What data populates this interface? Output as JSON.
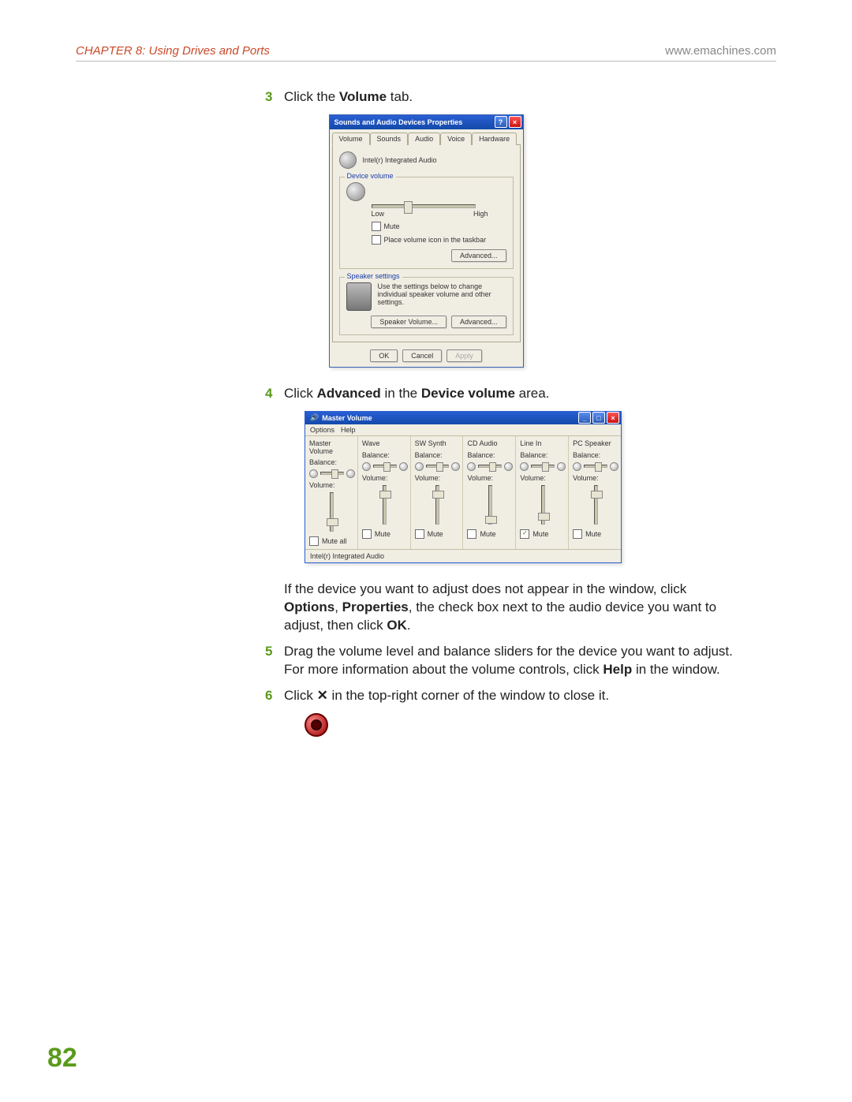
{
  "header": {
    "chapter": "CHAPTER 8: Using Drives and Ports",
    "url": "www.emachines.com"
  },
  "steps": {
    "s3": {
      "n": "3",
      "pre": "Click the ",
      "bold": "Volume",
      "post": " tab."
    },
    "s4": {
      "n": "4",
      "pre": "Click ",
      "b1": "Advanced",
      "mid": " in the ",
      "b2": "Device volume",
      "post": " area."
    },
    "sNote": {
      "pre": "If the device you want to adjust does not appear in the window, click ",
      "b1": "Options",
      "c1": ", ",
      "b2": "Properties",
      "mid": ", the check box next to the audio device you want to adjust, then click ",
      "b3": "OK",
      "post": "."
    },
    "s5": {
      "n": "5",
      "pre": "Drag the volume level and balance sliders for the device you want to adjust. For more information about the volume controls, click ",
      "b1": "Help",
      "post": " in the window."
    },
    "s6": {
      "n": "6",
      "pre": "Click ",
      "sym": "✕",
      "post": " in the top-right corner of the window to close it."
    }
  },
  "dlg1": {
    "title": "Sounds and Audio Devices Properties",
    "tabs": [
      "Volume",
      "Sounds",
      "Audio",
      "Voice",
      "Hardware"
    ],
    "device_name": "Intel(r) Integrated Audio",
    "device_volume_legend": "Device volume",
    "low": "Low",
    "high": "High",
    "mute": "Mute",
    "place_icon": "Place volume icon in the taskbar",
    "advanced_btn": "Advanced...",
    "speaker_legend": "Speaker settings",
    "speaker_desc": "Use the settings below to change individual speaker volume and other settings.",
    "speaker_volume_btn": "Speaker Volume...",
    "advanced_btn2": "Advanced...",
    "ok": "OK",
    "cancel": "Cancel",
    "apply": "Apply"
  },
  "dlg2": {
    "title": "Master Volume",
    "menu_options": "Options",
    "menu_help": "Help",
    "balance_label": "Balance:",
    "volume_label": "Volume:",
    "mute_all": "Mute all",
    "mute": "Mute",
    "status": "Intel(r) Integrated Audio",
    "columns": [
      {
        "name": "Master Volume",
        "vpos": 32,
        "muted": false,
        "mute_label": "Mute all"
      },
      {
        "name": "Wave",
        "vpos": 6,
        "muted": false,
        "mute_label": "Mute"
      },
      {
        "name": "SW Synth",
        "vpos": 6,
        "muted": false,
        "mute_label": "Mute"
      },
      {
        "name": "CD Audio",
        "vpos": 38,
        "muted": false,
        "mute_label": "Mute"
      },
      {
        "name": "Line In",
        "vpos": 34,
        "muted": true,
        "mute_label": "Mute"
      },
      {
        "name": "PC Speaker",
        "vpos": 6,
        "muted": false,
        "mute_label": "Mute"
      }
    ]
  },
  "page_number": "82"
}
